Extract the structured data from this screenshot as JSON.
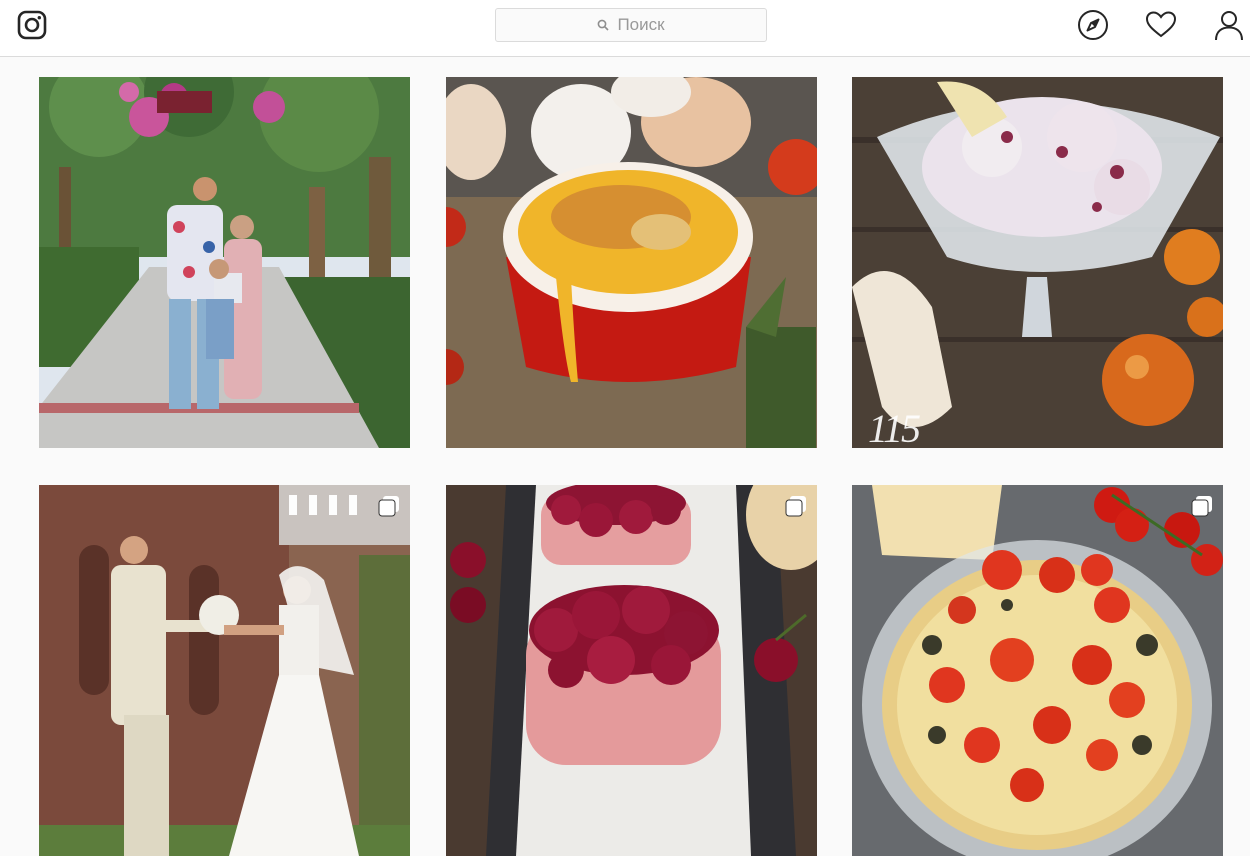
{
  "header": {
    "logo_icon": "instagram-logo-icon",
    "search": {
      "placeholder": "Поиск",
      "icon": "search-icon"
    },
    "nav": [
      {
        "name": "explore",
        "icon": "compass-icon"
      },
      {
        "name": "activity",
        "icon": "heart-icon"
      },
      {
        "name": "profile",
        "icon": "person-icon"
      }
    ]
  },
  "posts": [
    {
      "subject": "family-photo",
      "multi": false
    },
    {
      "subject": "egg-souffle-ramekin",
      "multi": false
    },
    {
      "subject": "banana-ice-cream",
      "multi": false,
      "overlay_text": "115"
    },
    {
      "subject": "wedding-couple",
      "multi": true
    },
    {
      "subject": "cherry-cakes",
      "multi": true
    },
    {
      "subject": "tomato-casserole",
      "multi": true
    }
  ],
  "colors": {
    "border": "#dbdbdb",
    "background": "#fafafa",
    "icon": "#262626",
    "placeholder": "#999999"
  }
}
